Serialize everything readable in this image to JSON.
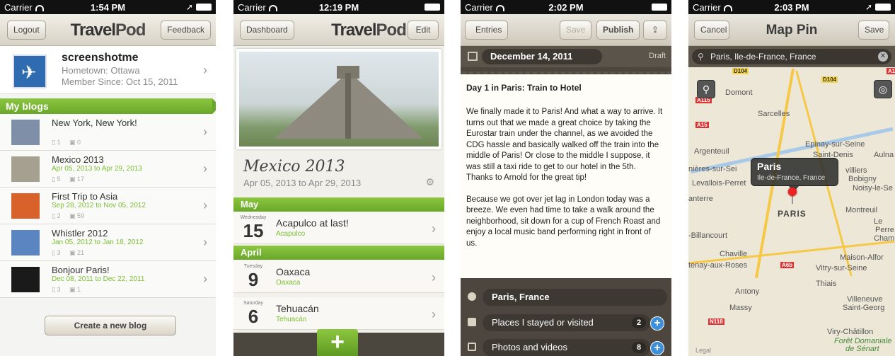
{
  "phone1": {
    "status": {
      "carrier": "Carrier",
      "time": "1:54 PM"
    },
    "nav": {
      "left": "Logout",
      "logo_a": "Travel",
      "logo_b": "Pod",
      "right": "Feedback"
    },
    "profile": {
      "name": "screenshotme",
      "hometown": "Hometown: Ottawa",
      "member_since": "Member Since: Oct 15, 2011"
    },
    "section": "My blogs",
    "blogs": [
      {
        "title": "New York, New York!",
        "dates": "",
        "entries": "1",
        "photos": "0",
        "thumb": "#7f8fa8"
      },
      {
        "title": "Mexico 2013",
        "dates": "Apr 05, 2013 to Apr 29, 2013",
        "entries": "5",
        "photos": "17",
        "thumb": "#a5a08f"
      },
      {
        "title": "First Trip to Asia",
        "dates": "Sep 28, 2012 to Nov 05, 2012",
        "entries": "2",
        "photos": "59",
        "thumb": "#d8622a"
      },
      {
        "title": "Whistler 2012",
        "dates": "Jan 05, 2012 to Jan 18, 2012",
        "entries": "3",
        "photos": "21",
        "thumb": "#5a85c0"
      },
      {
        "title": "Bonjour Paris!",
        "dates": "Dec 08, 2011 to Dec 22, 2011",
        "entries": "3",
        "photos": "1",
        "thumb": "#1a1a1a"
      }
    ],
    "create_button": "Create a new blog"
  },
  "phone2": {
    "status": {
      "carrier": "Carrier",
      "time": "12:19 PM"
    },
    "nav": {
      "left": "Dashboard",
      "logo_a": "Travel",
      "logo_b": "Pod",
      "right": "Edit"
    },
    "blog_title": "Mexico 2013",
    "blog_dates": "Apr 05, 2013 to Apr 29, 2013",
    "months": [
      {
        "name": "May",
        "entries": [
          {
            "weekday": "Wednesday",
            "day": "15",
            "title": "Acapulco at last!",
            "place": "Acapulco"
          }
        ]
      },
      {
        "name": "April",
        "entries": [
          {
            "weekday": "Tuesday",
            "day": "9",
            "title": "Oaxaca",
            "place": "Oaxaca"
          },
          {
            "weekday": "Saturday",
            "day": "6",
            "title": "Tehuacán",
            "place": "Tehuacán"
          }
        ]
      }
    ],
    "add_button": "+"
  },
  "phone3": {
    "status": {
      "carrier": "Carrier",
      "time": "2:02 PM"
    },
    "nav": {
      "back": "Entries",
      "save": "Save",
      "publish": "Publish"
    },
    "date": "December 14, 2011",
    "draft": "Draft",
    "entry_title": "Day 1 in Paris: Train to Hotel",
    "paragraphs": [
      "We finally made it to Paris! And what a way to arrive. It turns out that we made a great choice by taking the Eurostar train under the channel, as we avoided the CDG hassle and basically walked off the train into the middle of Paris! Or close to the middle I suppose, it was still a taxi ride to get to our hotel in the 5th. Thanks to Arnold for the great tip!",
      "Because we got over jet lag in London today was a breeze. We even had time to take a walk around the neighborhood, sit down for a cup of French Roast and enjoy a local music band performing right in front of us."
    ],
    "location": "Paris, France",
    "places": {
      "label": "Places I stayed or visited",
      "count": "2"
    },
    "photos": {
      "label": "Photos and videos",
      "count": "8"
    }
  },
  "phone4": {
    "status": {
      "carrier": "Carrier",
      "time": "2:03 PM"
    },
    "nav": {
      "left": "Cancel",
      "title": "Map Pin",
      "right": "Save"
    },
    "search_value": "Paris, Ile-de-France, France",
    "callout": {
      "title": "Paris",
      "subtitle": "Ile-de-France, France"
    },
    "map_labels": {
      "domont": "Domont",
      "sarcelles": "Sarcelles",
      "epinay": "Epinay-sur-Seine",
      "argenteuil": "Argenteuil",
      "saint_denis": "Saint-Denis",
      "aulnay": "Aulna",
      "nieres": "nières-sur-Sei",
      "villiers": "villiers",
      "bobigny": "Bobigny",
      "levallois": "Levallois-Perret",
      "noisy": "Noisy-le-Se",
      "anterre": "anterre",
      "paris": "PARIS",
      "montreuil": "Montreuil",
      "billancourt": "-Billancourt",
      "perreux": "Perre",
      "champ": "Champ",
      "le": "Le",
      "chaville": "Chaville",
      "maison": "Maison-Alfor",
      "tenay": "tenay-aux-Roses",
      "vitry": "Vitry-sur-Seine",
      "thiais": "Thiais",
      "antony": "Antony",
      "massy": "Massy",
      "villeneuve": "Villeneuve",
      "saint_georg": "Saint-Georg",
      "viry": "Viry-Châtillon",
      "foret": "Forêt Domaniale",
      "senart": "de Sénart",
      "legal": "Legal"
    },
    "roads": {
      "d104a": "D104",
      "d104b": "D104",
      "a115": "A115",
      "a15": "A15",
      "a6b": "A6b",
      "n118": "N118",
      "a1": "A1"
    }
  }
}
